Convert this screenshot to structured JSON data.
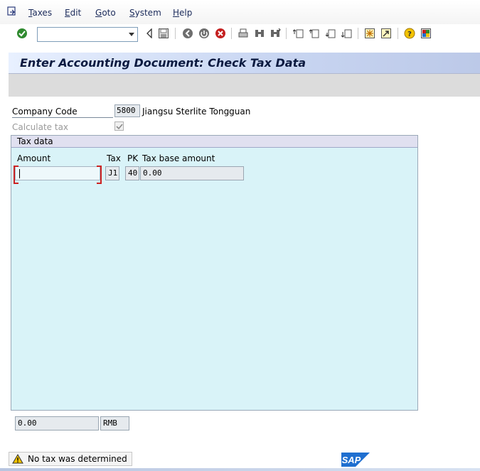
{
  "menu": {
    "items": [
      {
        "label": "Taxes",
        "mnemonic": "T",
        "rest": "axes"
      },
      {
        "label": "Edit",
        "mnemonic": "E",
        "rest": "dit"
      },
      {
        "label": "Goto",
        "mnemonic": "G",
        "rest": "oto"
      },
      {
        "label": "System",
        "mnemonic": "S",
        "rest": "ystem"
      },
      {
        "label": "Help",
        "mnemonic": "H",
        "rest": "elp"
      }
    ]
  },
  "toolbar": {
    "command_field_value": "",
    "icons": [
      "enter-check-icon",
      "back-triangle-icon",
      "save-icon",
      "back-icon",
      "exit-icon",
      "cancel-icon",
      "print-icon",
      "find-icon",
      "find-next-icon",
      "first-page-icon",
      "previous-page-icon",
      "next-page-icon",
      "last-page-icon",
      "create-session-icon",
      "shortcut-icon",
      "help-icon",
      "layout-menu-icon"
    ]
  },
  "title": "Enter Accounting Document: Check Tax Data",
  "form": {
    "company_code_label": "Company Code",
    "company_code_value": "5800",
    "company_name": "Jiangsu Sterlite Tongguan",
    "calculate_tax_label": "Calculate tax",
    "calculate_tax_checked": true
  },
  "tax_data": {
    "group_title": "Tax data",
    "columns": {
      "amount": "Amount",
      "tax": "Tax",
      "pk": "PK",
      "base": "Tax base amount"
    },
    "row": {
      "amount": "",
      "tax": "J1",
      "pk": "40",
      "base": "0.00"
    }
  },
  "totals": {
    "amount": "0.00",
    "currency": "RMB"
  },
  "status": {
    "message": "No tax was determined",
    "logo_text": "SAP"
  },
  "colors": {
    "title_text": "#0b1a40",
    "group_bg": "#d9f3f8",
    "warning": "#f3c300",
    "sap_blue": "#1f6fd0"
  }
}
